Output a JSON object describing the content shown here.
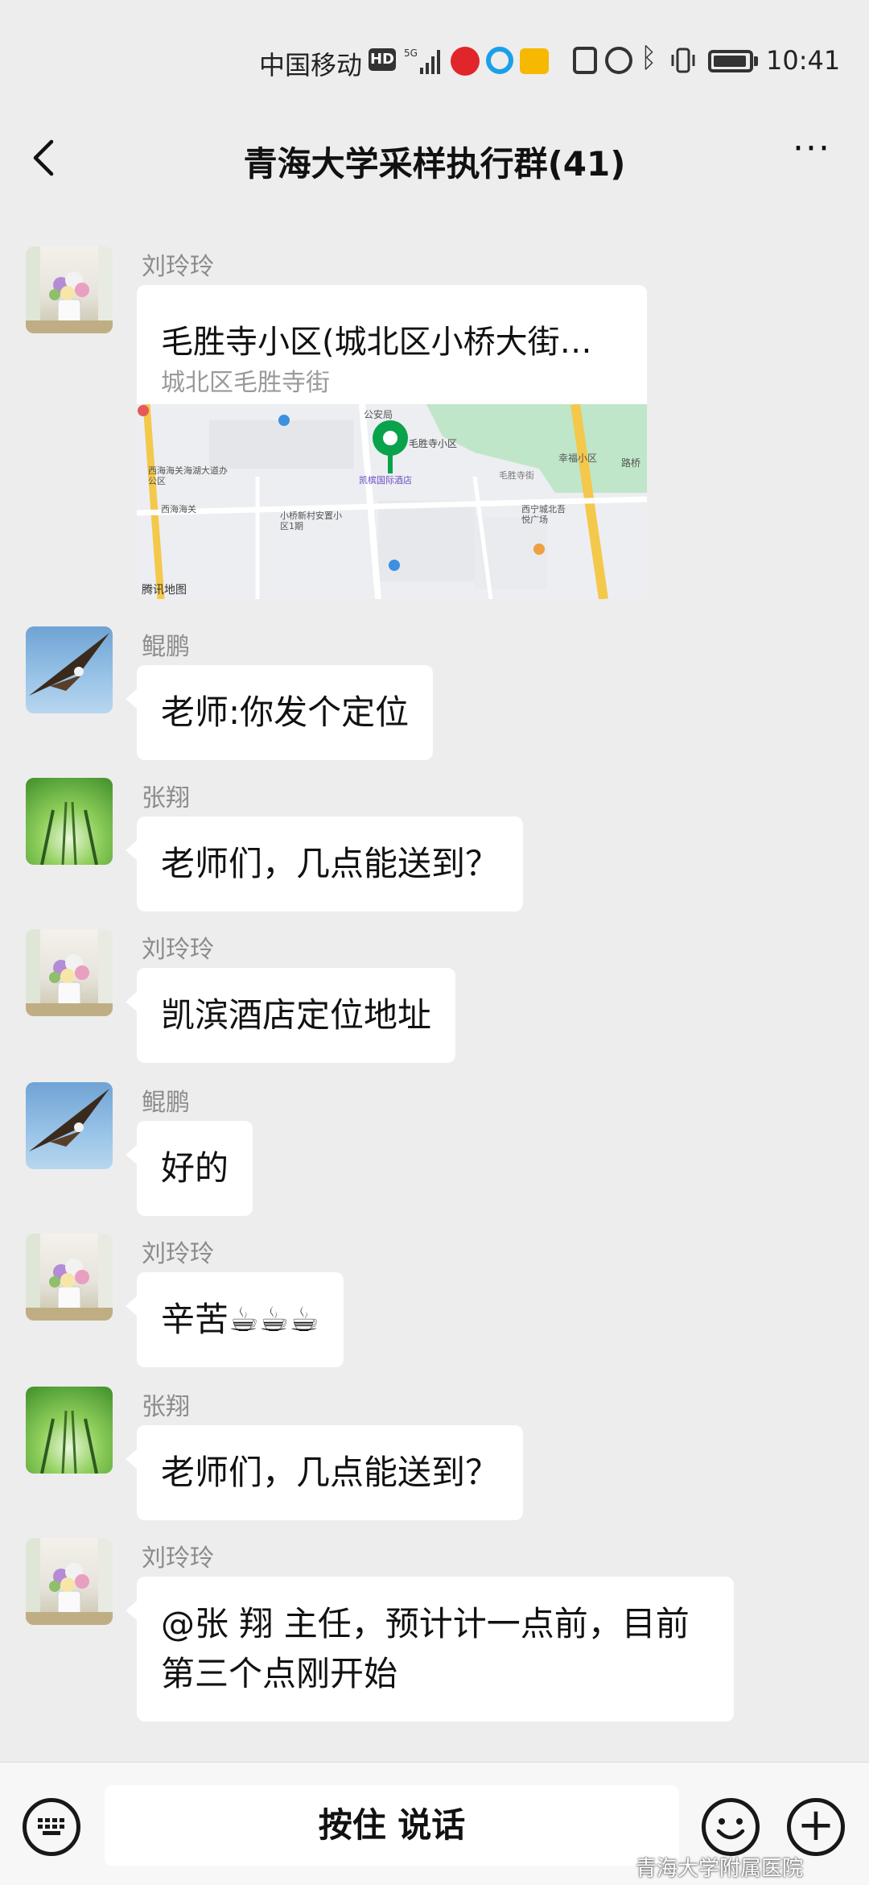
{
  "status_bar": {
    "carrier": "中国移动",
    "hd": "HD",
    "time": "10:41"
  },
  "header": {
    "title": "青海大学采样执行群(41)",
    "more_label": "···"
  },
  "messages": [
    {
      "sender": "刘玲玲",
      "type": "location",
      "title": "毛胜寺小区(城北区小桥大街…",
      "address": "城北区毛胜寺街",
      "map_labels": [
        "公安局",
        "毛胜寺小区",
        "凯槟国际酒店",
        "幸福小区",
        "路桥",
        "西海海关海湖大道办公区",
        "西海海关",
        "小桥新村安置小区1期",
        "西宁城北吾悦广场",
        "毛胜寺街",
        "腾讯地图"
      ]
    },
    {
      "sender": "鲲鹏",
      "type": "text",
      "text": "老师:你发个定位"
    },
    {
      "sender": "张翔",
      "type": "text",
      "text": "老师们，几点能送到？"
    },
    {
      "sender": "刘玲玲",
      "type": "text",
      "text": "凯滨酒店定位地址"
    },
    {
      "sender": "鲲鹏",
      "type": "text",
      "text": "好的"
    },
    {
      "sender": "刘玲玲",
      "type": "text",
      "text": "辛苦☕☕☕"
    },
    {
      "sender": "张翔",
      "type": "text",
      "text": "老师们，几点能送到？"
    },
    {
      "sender": "刘玲玲",
      "type": "text",
      "text": "@张  翔  主任，预计计一点前，目前第三个点刚开始"
    }
  ],
  "input_bar": {
    "voice_label": "按住 说话"
  },
  "watermark": "青海大学附属医院"
}
